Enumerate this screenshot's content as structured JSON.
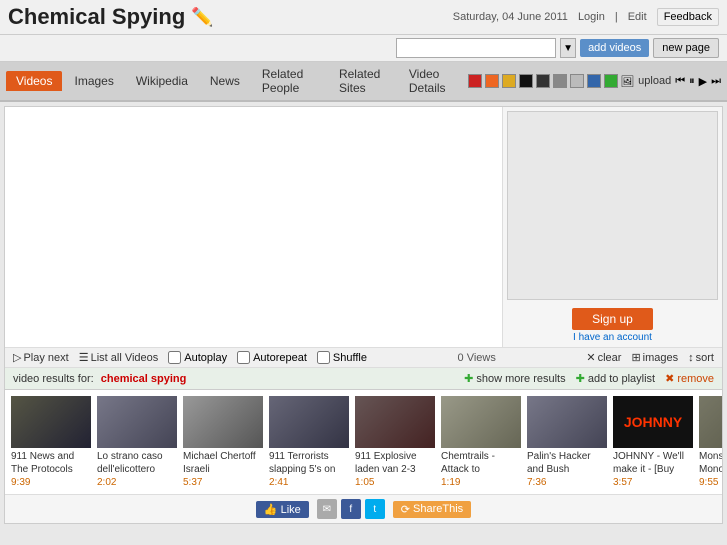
{
  "site": {
    "title": "Chemical Spying",
    "pencil_emoji": "✏️"
  },
  "header": {
    "date": "Saturday, 04 June 2011",
    "login_label": "Login",
    "edit_label": "Edit",
    "feedback_label": "Feedback",
    "add_videos_label": "add videos",
    "new_page_label": "new page"
  },
  "nav": {
    "tabs": [
      {
        "label": "Videos",
        "active": true
      },
      {
        "label": "Images",
        "active": false
      },
      {
        "label": "Wikipedia",
        "active": false
      },
      {
        "label": "News",
        "active": false
      },
      {
        "label": "Related People",
        "active": false
      },
      {
        "label": "Related Sites",
        "active": false
      },
      {
        "label": "Video Details",
        "active": false
      }
    ],
    "upload_label": "upload"
  },
  "playback": {
    "play_next_label": "Play next",
    "list_all_label": "List all Videos",
    "autoplay_label": "Autoplay",
    "autorepeat_label": "Autorepeat",
    "shuffle_label": "Shuffle",
    "views_label": "0 Views",
    "clear_label": "clear",
    "images_label": "images",
    "sort_label": "sort"
  },
  "results": {
    "label": "video results for:",
    "query": "chemical spying",
    "show_more_label": "show more results",
    "add_playlist_label": "add to playlist",
    "remove_label": "remove"
  },
  "signup": {
    "button_label": "Sign up",
    "account_label": "I have an account"
  },
  "videos": [
    {
      "title": "911 News and The Protocols",
      "duration": "9:39",
      "thumb_class": "thumb-1"
    },
    {
      "title": "Lo strano caso dell'elicottero",
      "duration": "2:02",
      "thumb_class": "thumb-2"
    },
    {
      "title": "Michael Chertoff Israeli",
      "duration": "5:37",
      "thumb_class": "thumb-3"
    },
    {
      "title": "911 Terrorists slapping 5's on",
      "duration": "2:41",
      "thumb_class": "thumb-4"
    },
    {
      "title": "911 Explosive laden van 2-3",
      "duration": "1:05",
      "thumb_class": "thumb-5"
    },
    {
      "title": "Chemtrails - Attack to",
      "duration": "1:19",
      "thumb_class": "thumb-6"
    },
    {
      "title": "Palin's Hacker and Bush",
      "duration": "7:36",
      "thumb_class": "thumb-2"
    },
    {
      "title": "JOHNNY - We'll make it - [Buy",
      "duration": "3:57",
      "thumb_class": "thumb-7"
    },
    {
      "title": "Monsanto Seed Monopoly",
      "duration": "9:55",
      "thumb_class": "thumb-8"
    }
  ],
  "social": {
    "like_label": "Like",
    "share_this_label": "ShareThis"
  },
  "colors": {
    "accent_orange": "#e05a1a",
    "accent_blue": "#5b8fc9",
    "result_red": "#cc0000"
  }
}
